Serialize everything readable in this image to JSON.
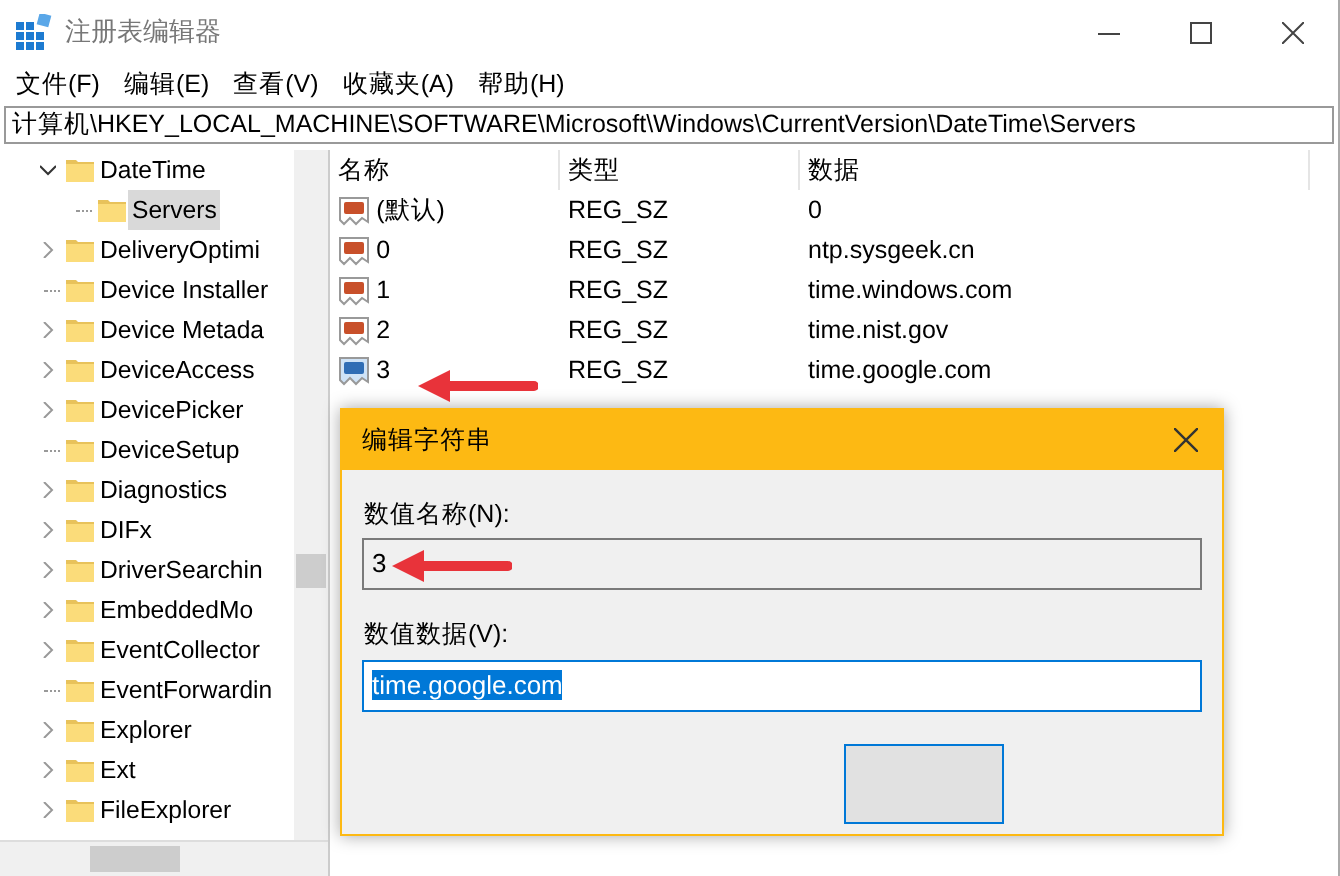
{
  "window": {
    "title": "注册表编辑器"
  },
  "menu": [
    "文件(F)",
    "编辑(E)",
    "查看(V)",
    "收藏夹(A)",
    "帮助(H)"
  ],
  "address": "计算机\\HKEY_LOCAL_MACHINE\\SOFTWARE\\Microsoft\\Windows\\CurrentVersion\\DateTime\\Servers",
  "tree": [
    {
      "label": "DateTime",
      "expanded": true,
      "selected": false,
      "children": [
        {
          "label": "Servers",
          "selected": true
        }
      ]
    },
    {
      "label": "DeliveryOptimi",
      "expanded": false,
      "selected": false
    },
    {
      "label": "Device Installer",
      "selected": false
    },
    {
      "label": "Device Metada",
      "expanded": false,
      "selected": false
    },
    {
      "label": "DeviceAccess",
      "expanded": false,
      "selected": false
    },
    {
      "label": "DevicePicker",
      "expanded": false,
      "selected": false
    },
    {
      "label": "DeviceSetup",
      "selected": false
    },
    {
      "label": "Diagnostics",
      "expanded": false,
      "selected": false
    },
    {
      "label": "DIFx",
      "expanded": false,
      "selected": false
    },
    {
      "label": "DriverSearchin",
      "expanded": false,
      "selected": false
    },
    {
      "label": "EmbeddedMo",
      "expanded": false,
      "selected": false
    },
    {
      "label": "EventCollector",
      "expanded": false,
      "selected": false
    },
    {
      "label": "EventForwardin",
      "selected": false
    },
    {
      "label": "Explorer",
      "expanded": false,
      "selected": false
    },
    {
      "label": "Ext",
      "expanded": false,
      "selected": false
    },
    {
      "label": "FileExplorer",
      "expanded": false,
      "selected": false
    }
  ],
  "table": {
    "columns": [
      "名称",
      "类型",
      "数据"
    ],
    "rows": [
      {
        "name": "(默认)",
        "type": "REG_SZ",
        "data": "0",
        "selected": false
      },
      {
        "name": "0",
        "type": "REG_SZ",
        "data": "ntp.sysgeek.cn",
        "selected": false
      },
      {
        "name": "1",
        "type": "REG_SZ",
        "data": "time.windows.com",
        "selected": false
      },
      {
        "name": "2",
        "type": "REG_SZ",
        "data": "time.nist.gov",
        "selected": false
      },
      {
        "name": "3",
        "type": "REG_SZ",
        "data": "time.google.com",
        "selected": true
      }
    ]
  },
  "dialog": {
    "title": "编辑字符串",
    "name_label": "数值名称(N):",
    "name_value": "3",
    "data_label": "数值数据(V):",
    "data_value": "time.google.com",
    "data_selected": true
  }
}
